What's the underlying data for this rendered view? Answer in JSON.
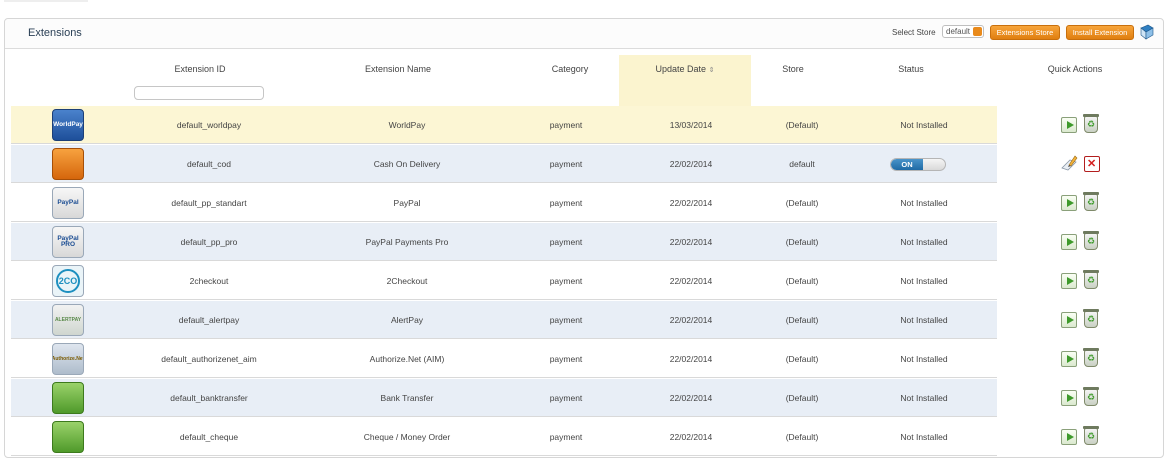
{
  "panel": {
    "title": "Extensions",
    "select_store_label": "Select Store",
    "store_select_value": "default",
    "extensions_store_button": "Extensions Store",
    "install_extension_button": "Install Extension"
  },
  "table": {
    "columns": [
      "Extension ID",
      "Extension Name",
      "Category",
      "Update Date",
      "Store",
      "Status",
      "Quick Actions"
    ],
    "sort_indicator": "⇕",
    "rows": [
      {
        "logo_text": "WorldPay",
        "logo_style": "blue",
        "id": "default_worldpay",
        "name": "WorldPay",
        "category": "payment",
        "date": "13/03/2014",
        "store": "(Default)",
        "status": "Not Installed",
        "installed": false
      },
      {
        "logo_text": "",
        "logo_style": "orange",
        "id": "default_cod",
        "name": "Cash On Delivery",
        "category": "payment",
        "date": "22/02/2014",
        "store": "default",
        "status": "ON",
        "installed": true
      },
      {
        "logo_text": "PayPal",
        "logo_style": "plain",
        "id": "default_pp_standart",
        "name": "PayPal",
        "category": "payment",
        "date": "22/02/2014",
        "store": "(Default)",
        "status": "Not Installed",
        "installed": false
      },
      {
        "logo_text": "PayPal PRO",
        "logo_style": "plain",
        "id": "default_pp_pro",
        "name": "PayPal Payments Pro",
        "category": "payment",
        "date": "22/02/2014",
        "store": "(Default)",
        "status": "Not Installed",
        "installed": false
      },
      {
        "logo_text": "2CO",
        "logo_style": "teal",
        "id": "2checkout",
        "name": "2Checkout",
        "category": "payment",
        "date": "22/02/2014",
        "store": "(Default)",
        "status": "Not Installed",
        "installed": false
      },
      {
        "logo_text": "ALERTPAY",
        "logo_style": "gray",
        "id": "default_alertpay",
        "name": "AlertPay",
        "category": "payment",
        "date": "22/02/2014",
        "store": "(Default)",
        "status": "Not Installed",
        "installed": false
      },
      {
        "logo_text": "Authorize.Net",
        "logo_style": "gold",
        "id": "default_authorizenet_aim",
        "name": "Authorize.Net (AIM)",
        "category": "payment",
        "date": "22/02/2014",
        "store": "(Default)",
        "status": "Not Installed",
        "installed": false
      },
      {
        "logo_text": "",
        "logo_style": "green",
        "id": "default_banktransfer",
        "name": "Bank Transfer",
        "category": "payment",
        "date": "22/02/2014",
        "store": "(Default)",
        "status": "Not Installed",
        "installed": false
      },
      {
        "logo_text": "",
        "logo_style": "green",
        "id": "default_cheque",
        "name": "Cheque / Money Order",
        "category": "payment",
        "date": "22/02/2014",
        "store": "(Default)",
        "status": "Not Installed",
        "installed": false
      }
    ]
  },
  "icons": {
    "help": "book-help-icon",
    "install": "play-icon",
    "uninstall": "recycle-bin-icon",
    "edit": "edit-pencil-icon",
    "delete": "delete-x-icon"
  },
  "colors": {
    "accent_orange": "#e98a1b",
    "highlight_row": "#fcf6d4",
    "alt_row": "#e8eef6",
    "toggle_on": "#1f6aa5"
  }
}
